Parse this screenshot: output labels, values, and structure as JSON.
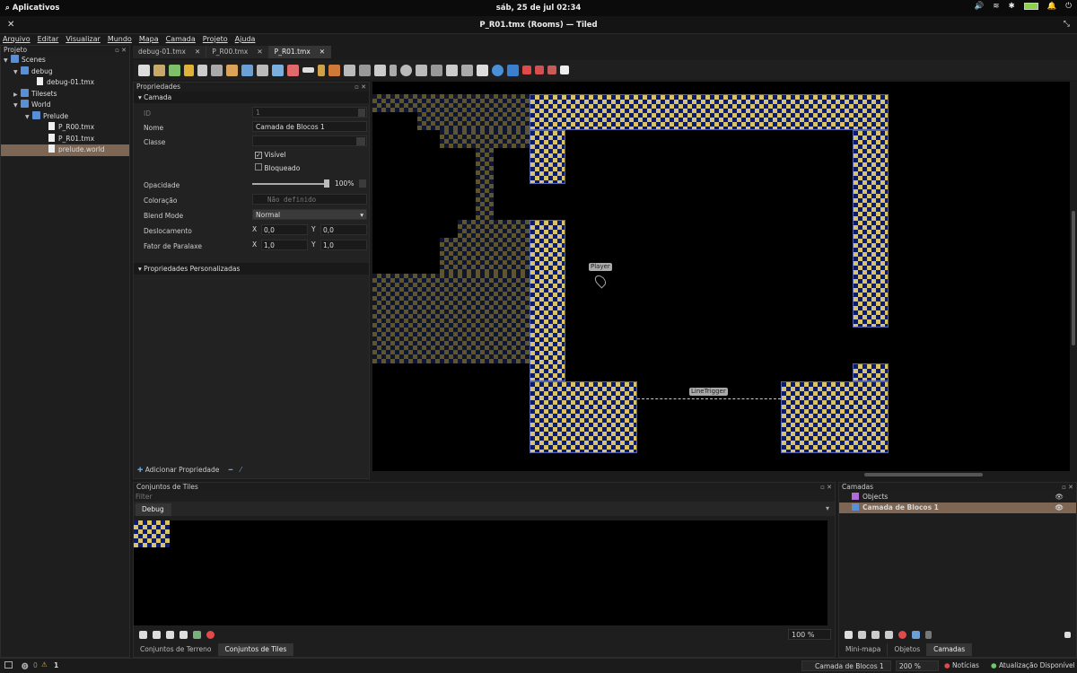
{
  "topbar": {
    "apps": "Aplicativos",
    "clock": "sáb, 25 de jul  02:34"
  },
  "window": {
    "title": "P_R01.tmx (Rooms) — Tiled"
  },
  "menu": [
    "Arquivo",
    "Editar",
    "Visualizar",
    "Mundo",
    "Mapa",
    "Camada",
    "Projeto",
    "Ajuda"
  ],
  "project": {
    "title": "Projeto",
    "items": [
      "Scenes",
      "debug",
      "debug-01.tmx",
      "Tilesets",
      "World",
      "Prelude",
      "P_R00.tmx",
      "P_R01.tmx",
      "prelude.world"
    ]
  },
  "tabs": [
    "debug-01.tmx",
    "P_R00.tmx",
    "P_R01.tmx"
  ],
  "properties": {
    "title": "Propriedades",
    "section": "Camada",
    "id_label": "ID",
    "id_value": "1",
    "name_label": "Nome",
    "name_value": "Camada de Blocos 1",
    "class_label": "Classe",
    "class_value": "",
    "visible_label": "Visível",
    "locked_label": "Bloqueado",
    "opacity_label": "Opacidade",
    "opacity_value": "100%",
    "tint_label": "Coloração",
    "tint_value": "Não definido",
    "blend_label": "Blend Mode",
    "blend_value": "Normal",
    "offset_label": "Deslocamento",
    "offset_x": "0,0",
    "offset_y": "0,0",
    "parallax_label": "Fator de Paralaxe",
    "parallax_x": "1,0",
    "parallax_y": "1,0",
    "x_label": "X",
    "y_label": "Y",
    "custom_section": "Propriedades Personalizadas",
    "add_property": "Adicionar Propriedade"
  },
  "map": {
    "player_label": "Player",
    "trigger_label": "LineTrigger"
  },
  "tilesets": {
    "title": "Conjuntos de Tiles",
    "filter_placeholder": "Filter",
    "tab": "Debug",
    "zoom": "100 %",
    "bottom_tabs": [
      "Conjuntos de Terreno",
      "Conjuntos de Tiles"
    ]
  },
  "layers": {
    "title": "Camadas",
    "items": [
      "Objects",
      "Camada de Blocos 1"
    ],
    "bottom_tabs": [
      "Mini-mapa",
      "Objetos",
      "Camadas"
    ]
  },
  "status": {
    "errors": "0",
    "warnings": "1",
    "layer": "Camada de Blocos 1",
    "zoom": "200 %",
    "news": "Notícias",
    "update": "Atualização Disponível"
  },
  "colors": {
    "selection": "#7d6653",
    "tile_blue": "#0a1b70",
    "tile_yellow": "#d8c26a"
  }
}
